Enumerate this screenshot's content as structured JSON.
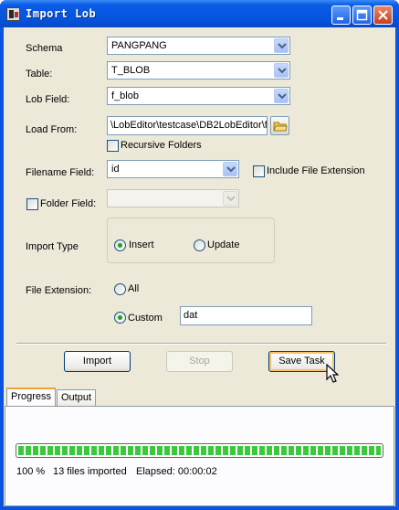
{
  "window": {
    "title": "Import Lob",
    "controls": [
      "minimize-icon",
      "maximize-icon",
      "close-icon"
    ]
  },
  "form": {
    "schema": {
      "label": "Schema",
      "value": "PANGPANG"
    },
    "table": {
      "label": "Table:",
      "value": "T_BLOB"
    },
    "lob_field": {
      "label": "Lob Field:",
      "value": "f_blob"
    },
    "load_from": {
      "label": "Load From:",
      "value": "\\LobEditor\\testcase\\DB2LobEditor\\f"
    },
    "recursive_folders": {
      "label": "Recursive Folders",
      "checked": false
    },
    "filename_field": {
      "label": "Filename Field:",
      "value": "id"
    },
    "include_file_extension": {
      "label": "Include File Extension",
      "checked": false
    },
    "folder_field": {
      "label": "Folder Field:",
      "checked": false,
      "value": ""
    },
    "import_type": {
      "label": "Import Type",
      "options": [
        "Insert",
        "Update"
      ],
      "selected": "Insert"
    },
    "file_extension": {
      "label": "File Extension:",
      "options": [
        "All",
        "Custom"
      ],
      "selected": "Custom",
      "custom_value": "dat"
    }
  },
  "buttons": {
    "import": "Import",
    "stop": "Stop",
    "save_task": "Save Task"
  },
  "tabs": [
    {
      "label": "Progress",
      "active": true
    },
    {
      "label": "Output",
      "active": false
    }
  ],
  "progress": {
    "fraction": 1.0,
    "percent_text": "100 %",
    "files_text": "13 files imported",
    "elapsed_text": "Elapsed: 00:00:02"
  },
  "colors": {
    "titlebar": "#0454de",
    "dialog_bg": "#ece9d8",
    "progress_green": "#3bc93b",
    "focus_orange": "#f7c26b"
  }
}
